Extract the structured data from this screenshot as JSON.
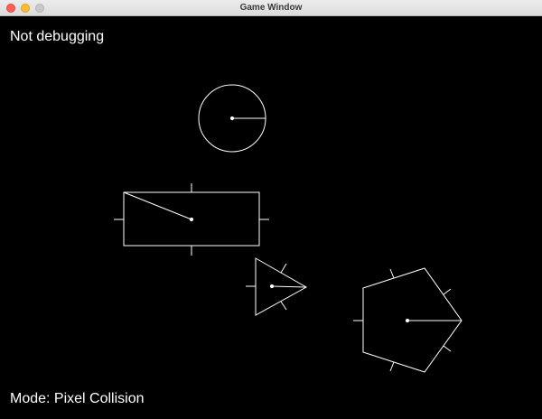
{
  "window": {
    "title": "Game Window"
  },
  "hud": {
    "debug_status": "Not debugging",
    "mode_label": "Mode: Pixel Collision"
  },
  "shapes": [
    "circle",
    "rectangle",
    "triangle",
    "pentagon"
  ],
  "colors": {
    "background": "#000000",
    "stroke": "#ffffff",
    "text": "#ffffff"
  }
}
